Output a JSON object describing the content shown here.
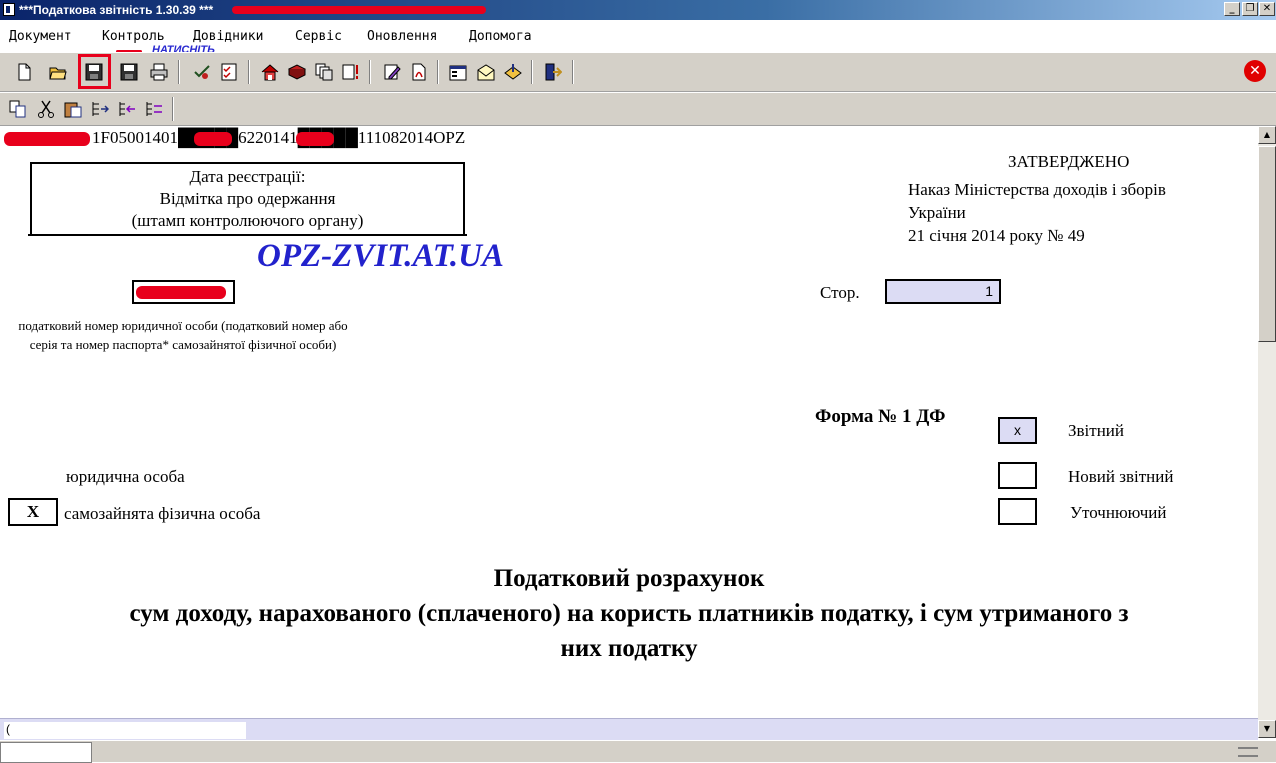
{
  "window": {
    "title": "***Податкова звітність 1.30.39 ***",
    "controls": {
      "minimize": "_",
      "restore": "❐",
      "close": "✕"
    }
  },
  "menu": {
    "items": [
      "Документ",
      "Контроль",
      "Довідники",
      "Сервіс",
      "Оновлення",
      "Допомога"
    ],
    "hint_label": "НАТИСНІТЬ"
  },
  "toolbar1": {
    "buttons": [
      "new-document-icon",
      "open-folder-icon",
      "save-icon",
      "save-as-icon",
      "print-icon",
      "check-icon",
      "checklist-icon",
      "home-icon",
      "book-icon",
      "copy-pages-icon",
      "alert-doc-icon",
      "edit-pen-icon",
      "pdf-doc-icon",
      "properties-icon",
      "mail-icon",
      "send-icon",
      "exit-door-icon"
    ],
    "close_icon": "close-circle-icon"
  },
  "toolbar2": {
    "buttons": [
      "copy-icon",
      "cut-icon",
      "paste-icon",
      "insert-row-icon",
      "move-rows-icon",
      "delete-rows-icon"
    ]
  },
  "document": {
    "barcode_text": "1F05001401█████6220141█████111082014OPZ",
    "stamp": {
      "line1": "Дата реєстрації:",
      "line2": "Відмітка про одержання",
      "line3": "(штамп контролюючого органу)"
    },
    "approved": "ЗАТВЕРДЖЕНО",
    "order_line1": "Наказ Міністерства доходів і зборів",
    "order_line2": "України",
    "order_line3": "21 січня 2014 року № 49",
    "watermark": "OPZ-ZVIT.AT.UA",
    "tax_id_caption": "податковий номер юридичної особи (податковий номер або серія та номер паспорта* самозайнятої фізичної особи)",
    "page_label": "Стор.",
    "page_value": "1",
    "form_title": "Форма № 1 ДФ",
    "report_types": [
      {
        "label": "Звітний",
        "mark": "x"
      },
      {
        "label": "Новий звітний",
        "mark": ""
      },
      {
        "label": "Уточнюючий",
        "mark": ""
      }
    ],
    "entity_types": [
      {
        "label": "юридична особа",
        "mark": ""
      },
      {
        "label": "самозайнята фізична особа",
        "mark": "X"
      }
    ],
    "heading_line1": "Податковий розрахунок",
    "heading_line2": "сум доходу, нарахованого (сплаченого) на користь платників податку, і сум утриманого з",
    "heading_line3": "них податку"
  },
  "status": {
    "field_value": "("
  },
  "colors": {
    "redaction": "#e8001c",
    "watermark": "#2222cc",
    "titlebar": "#0a246a",
    "field_fill": "#dcdcf4"
  }
}
